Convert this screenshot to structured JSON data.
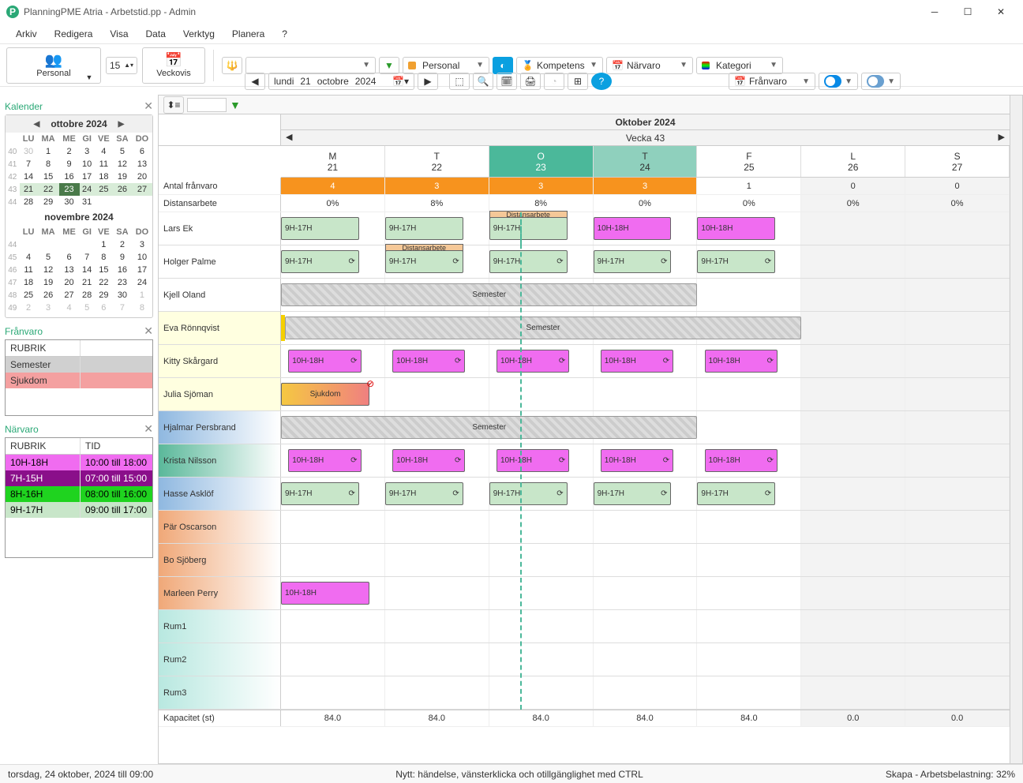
{
  "title": "PlanningPME Atria - Arbetstid.pp - Admin",
  "menu": [
    "Arkiv",
    "Redigera",
    "Visa",
    "Data",
    "Verktyg",
    "Planera",
    "?"
  ],
  "toolbar": {
    "personal": "Personal",
    "spin": "15",
    "veckovis": "Veckovis",
    "date_day": "lundi",
    "date_d": "21",
    "date_m": "octobre",
    "date_y": "2024",
    "dd_personal": "Personal",
    "dd_kompetens": "Kompetens",
    "dd_narvaro": "Närvaro",
    "dd_kategori": "Kategori",
    "dd_franvaro": "Frånvaro"
  },
  "sidebar": {
    "kalender": "Kalender",
    "month1": "ottobre 2024",
    "month2": "novembre 2024",
    "dows": [
      "LU",
      "MA",
      "ME",
      "GI",
      "VE",
      "SA",
      "DO"
    ],
    "oct": {
      "rows": [
        {
          "wk": "40",
          "d": [
            "30",
            "1",
            "2",
            "3",
            "4",
            "5",
            "6"
          ],
          "dim": [
            0
          ]
        },
        {
          "wk": "41",
          "d": [
            "7",
            "8",
            "9",
            "10",
            "11",
            "12",
            "13"
          ]
        },
        {
          "wk": "42",
          "d": [
            "14",
            "15",
            "16",
            "17",
            "18",
            "19",
            "20"
          ]
        },
        {
          "wk": "43",
          "d": [
            "21",
            "22",
            "23",
            "24",
            "25",
            "26",
            "27"
          ],
          "cwk": true,
          "today": 2
        },
        {
          "wk": "44",
          "d": [
            "28",
            "29",
            "30",
            "31",
            "",
            "",
            ""
          ]
        }
      ]
    },
    "nov": {
      "rows": [
        {
          "wk": "44",
          "d": [
            "",
            "",
            "",
            "",
            "1",
            "2",
            "3"
          ]
        },
        {
          "wk": "45",
          "d": [
            "4",
            "5",
            "6",
            "7",
            "8",
            "9",
            "10"
          ]
        },
        {
          "wk": "46",
          "d": [
            "11",
            "12",
            "13",
            "14",
            "15",
            "16",
            "17"
          ]
        },
        {
          "wk": "47",
          "d": [
            "18",
            "19",
            "20",
            "21",
            "22",
            "23",
            "24"
          ]
        },
        {
          "wk": "48",
          "d": [
            "25",
            "26",
            "27",
            "28",
            "29",
            "30",
            "1"
          ],
          "dim": [
            6
          ]
        },
        {
          "wk": "49",
          "d": [
            "2",
            "3",
            "4",
            "5",
            "6",
            "7",
            "8"
          ],
          "dim": [
            0,
            1,
            2,
            3,
            4,
            5,
            6
          ]
        }
      ]
    },
    "franvaro": "Frånvaro",
    "rubrik": "RUBRIK",
    "franvaro_items": [
      {
        "lbl": "Semester",
        "bg": "#d0d0d0"
      },
      {
        "lbl": "Sjukdom",
        "bg": "#f4a0a0"
      }
    ],
    "narvaro": "Närvaro",
    "tid": "TID",
    "narvaro_items": [
      {
        "r": "10H-18H",
        "t": "10:00 till 18:00",
        "bg": "#f06cf0"
      },
      {
        "r": "7H-15H",
        "t": "07:00 till 15:00",
        "bg": "#8a0f8a",
        "fg": "#fff"
      },
      {
        "r": "8H-16H",
        "t": "08:00 till 16:00",
        "bg": "#1fd31f"
      },
      {
        "r": "9H-17H",
        "t": "09:00 till 17:00",
        "bg": "#c8e6c9"
      }
    ]
  },
  "grid": {
    "month": "Oktober 2024",
    "week": "Vecka 43",
    "days": [
      {
        "dow": "M",
        "date": "21"
      },
      {
        "dow": "T",
        "date": "22"
      },
      {
        "dow": "O",
        "date": "23",
        "today": true
      },
      {
        "dow": "T",
        "date": "24",
        "today2": true
      },
      {
        "dow": "F",
        "date": "25"
      },
      {
        "dow": "L",
        "date": "26",
        "wknd": true
      },
      {
        "dow": "S",
        "date": "27",
        "wknd": true
      }
    ],
    "antal": "Antal frånvaro",
    "antal_vals": [
      "4",
      "3",
      "3",
      "3",
      "1",
      "0",
      "0"
    ],
    "dist": "Distansarbete",
    "dist_vals": [
      "0%",
      "8%",
      "8%",
      "0%",
      "0%",
      "0%",
      "0%"
    ],
    "kap": "Kapacitet (st)",
    "kap_vals": [
      "84.0",
      "84.0",
      "84.0",
      "84.0",
      "84.0",
      "0.0",
      "0.0"
    ],
    "dist_lbl": "Distansarbete",
    "sem_lbl": "Semester",
    "sick_lbl": "Sjukdom",
    "e_9": "9H-17H",
    "e_10": "10H-18H",
    "resources": [
      {
        "name": "Lars Ek"
      },
      {
        "name": "Holger Palme"
      },
      {
        "name": "Kjell Oland"
      },
      {
        "name": "Eva Rönnqvist",
        "cls": "yel"
      },
      {
        "name": "Kitty Skårgard",
        "cls": "yel"
      },
      {
        "name": "Julia Sjöman",
        "cls": "yel"
      },
      {
        "name": "Hjalmar Persbrand",
        "cls": "blu"
      },
      {
        "name": "Krista Nilsson",
        "cls": "grn"
      },
      {
        "name": "Hasse Asklöf",
        "cls": "blu"
      },
      {
        "name": "Pär Oscarson",
        "cls": "orn"
      },
      {
        "name": "Bo Sjöberg",
        "cls": "orn"
      },
      {
        "name": "Marleen Perry",
        "cls": "orn"
      },
      {
        "name": "Rum1",
        "cls": "cyn"
      },
      {
        "name": "Rum2",
        "cls": "cyn"
      },
      {
        "name": "Rum3",
        "cls": "cyn"
      }
    ]
  },
  "status": {
    "left": "torsdag, 24 oktober, 2024 till 09:00",
    "mid": "Nytt: händelse, vänsterklicka och otillgänglighet med CTRL",
    "right": "Skapa - Arbetsbelastning: 32%"
  }
}
